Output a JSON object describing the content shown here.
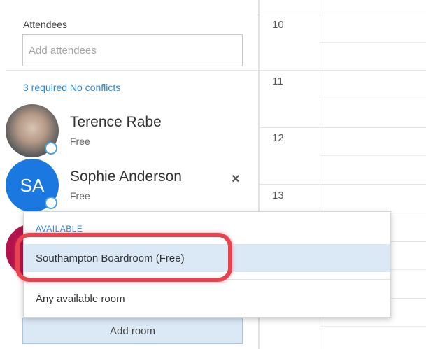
{
  "attendees": {
    "label": "Attendees",
    "input_placeholder": "Add attendees",
    "summary": "3 required No conflicts"
  },
  "people": [
    {
      "name": "Terence Rabe",
      "status": "Free",
      "avatar": "photo"
    },
    {
      "name": "Sophie Anderson",
      "initials": "SA",
      "status": "Free",
      "remove_label": "×",
      "avatar_color": "#1a78e0"
    }
  ],
  "calendar": {
    "hours": [
      "10",
      "11",
      "12",
      "13"
    ]
  },
  "room_dropdown": {
    "header": "AVAILABLE",
    "selected_item": "Southampton Boardroom  (Free)",
    "other_item": "Any available room"
  },
  "add_room": {
    "label": "Add room"
  },
  "colors": {
    "link_blue": "#2b88d8",
    "avatar_blue": "#1a78e0",
    "highlight_red": "#e8434f",
    "selected_bg": "#dbe9f6",
    "third_avatar": "#b3134d"
  }
}
